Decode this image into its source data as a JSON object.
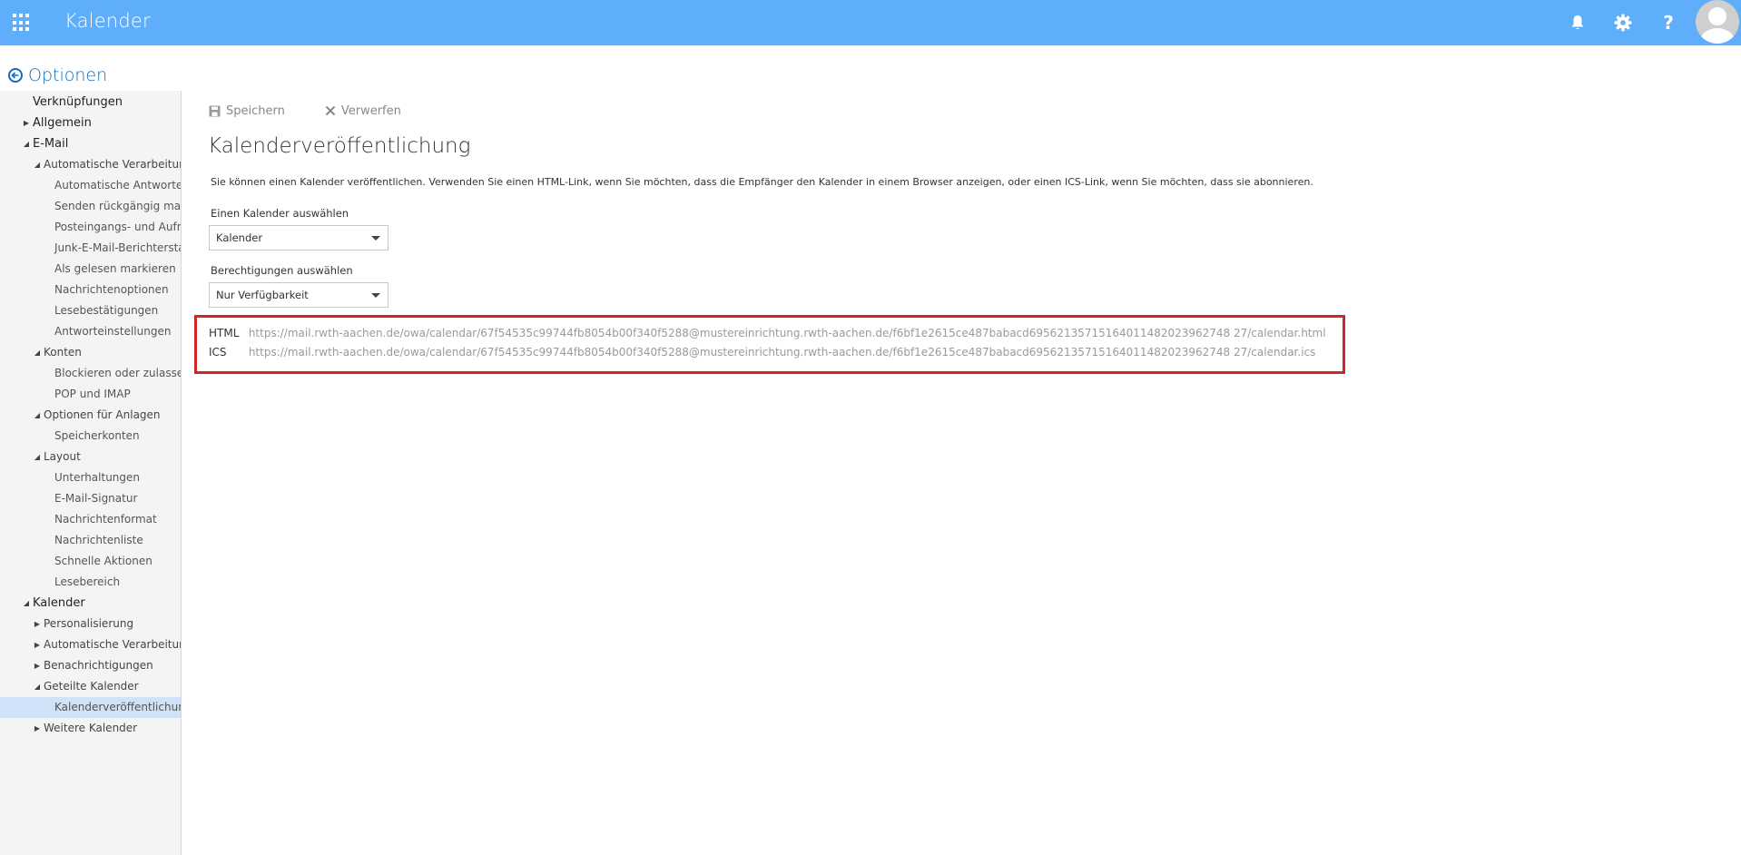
{
  "header": {
    "app_title": "Kalender",
    "icons": [
      "waffle-icon",
      "bell-icon",
      "gear-icon",
      "help-icon",
      "avatar"
    ],
    "accent_color": "#5eaefc"
  },
  "sidebar": {
    "back_title": "Optionen",
    "items": [
      {
        "label": "Verknüpfungen",
        "level": 0,
        "arrow": "none"
      },
      {
        "label": "Allgemein",
        "level": 0,
        "arrow": "collapsed"
      },
      {
        "label": "E-Mail",
        "level": 0,
        "arrow": "expanded"
      },
      {
        "label": "Automatische Verarbeitung",
        "level": 1,
        "arrow": "expanded"
      },
      {
        "label": "Automatische Antworten",
        "level": 2,
        "arrow": "none"
      },
      {
        "label": "Senden rückgängig machen",
        "level": 2,
        "arrow": "none"
      },
      {
        "label": "Posteingangs- und Aufräumregeln",
        "level": 2,
        "arrow": "none"
      },
      {
        "label": "Junk-E-Mail-Berichterstattung",
        "level": 2,
        "arrow": "none"
      },
      {
        "label": "Als gelesen markieren",
        "level": 2,
        "arrow": "none"
      },
      {
        "label": "Nachrichtenoptionen",
        "level": 2,
        "arrow": "none"
      },
      {
        "label": "Lesebestätigungen",
        "level": 2,
        "arrow": "none"
      },
      {
        "label": "Antworteinstellungen",
        "level": 2,
        "arrow": "none"
      },
      {
        "label": "Konten",
        "level": 1,
        "arrow": "expanded"
      },
      {
        "label": "Blockieren oder zulassen",
        "level": 2,
        "arrow": "none"
      },
      {
        "label": "POP und IMAP",
        "level": 2,
        "arrow": "none"
      },
      {
        "label": "Optionen für Anlagen",
        "level": 1,
        "arrow": "expanded"
      },
      {
        "label": "Speicherkonten",
        "level": 2,
        "arrow": "none"
      },
      {
        "label": "Layout",
        "level": 1,
        "arrow": "expanded"
      },
      {
        "label": "Unterhaltungen",
        "level": 2,
        "arrow": "none"
      },
      {
        "label": "E-Mail-Signatur",
        "level": 2,
        "arrow": "none"
      },
      {
        "label": "Nachrichtenformat",
        "level": 2,
        "arrow": "none"
      },
      {
        "label": "Nachrichtenliste",
        "level": 2,
        "arrow": "none"
      },
      {
        "label": "Schnelle Aktionen",
        "level": 2,
        "arrow": "none"
      },
      {
        "label": "Lesebereich",
        "level": 2,
        "arrow": "none"
      },
      {
        "label": "Kalender",
        "level": 0,
        "arrow": "expanded"
      },
      {
        "label": "Personalisierung",
        "level": 1,
        "arrow": "collapsed"
      },
      {
        "label": "Automatische Verarbeitung",
        "level": 1,
        "arrow": "collapsed"
      },
      {
        "label": "Benachrichtigungen",
        "level": 1,
        "arrow": "collapsed"
      },
      {
        "label": "Geteilte Kalender",
        "level": 1,
        "arrow": "expanded"
      },
      {
        "label": "Kalenderveröffentlichung",
        "level": 2,
        "arrow": "none",
        "selected": true
      },
      {
        "label": "Weitere Kalender",
        "level": 1,
        "arrow": "collapsed"
      }
    ]
  },
  "toolbar": {
    "save_label": "Speichern",
    "discard_label": "Verwerfen"
  },
  "main": {
    "title": "Kalenderveröffentlichung",
    "description": "Sie können einen Kalender veröffentlichen. Verwenden Sie einen HTML-Link, wenn Sie möchten, dass die Empfänger den Kalender in einem Browser anzeigen, oder einen ICS-Link, wenn Sie möchten, dass sie abonnieren.",
    "calendar_select_label": "Einen Kalender auswählen",
    "calendar_select_value": "Kalender",
    "permissions_select_label": "Berechtigungen auswählen",
    "permissions_select_value": "Nur Verfügbarkeit",
    "links": [
      {
        "label": "HTML",
        "url": "https://mail.rwth-aachen.de/owa/calendar/67f54535c99744fb8054b00f340f5288@mustereinrichtung.rwth-aachen.de/f6bf1e2615ce487babacd69562135715164011482023962748 27/calendar.html"
      },
      {
        "label": "ICS",
        "url": "https://mail.rwth-aachen.de/owa/calendar/67f54535c99744fb8054b00f340f5288@mustereinrichtung.rwth-aachen.de/f6bf1e2615ce487babacd69562135715164011482023962748 27/calendar.ics"
      }
    ],
    "highlight_color": "#d1232a"
  }
}
